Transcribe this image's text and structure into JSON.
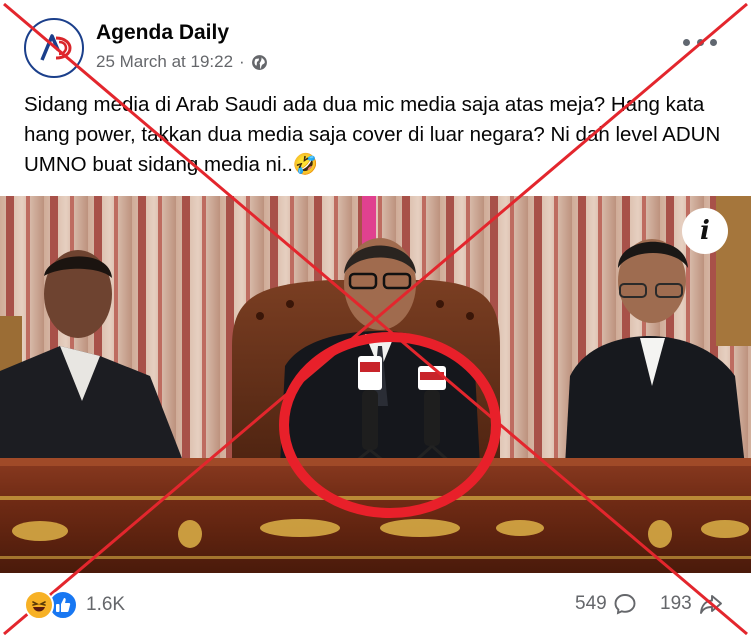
{
  "post": {
    "author": "Agenda Daily",
    "timestamp": "25 March at 19:22",
    "separator": "·",
    "audience_icon": "globe-icon",
    "more_icon": "more-options-icon",
    "caption": "Sidang media di Arab Saudi ada dua mic media saja atas meja? Hang kata hang power, takkan dua media saja cover di luar negara? Ni dah level ADUN UMNO buat sidang media ni..🤣"
  },
  "photo": {
    "info_label": "i"
  },
  "footer": {
    "reaction_icons": [
      "haha-icon",
      "like-icon"
    ],
    "reaction_count": "1.6K",
    "comment_count": "549",
    "share_count": "193"
  },
  "colors": {
    "fact_check_cross": "#e3262d",
    "circle": "#e8202a",
    "like": "#1877f2",
    "haha": "#f7b125",
    "secondary_text": "#65676b"
  }
}
